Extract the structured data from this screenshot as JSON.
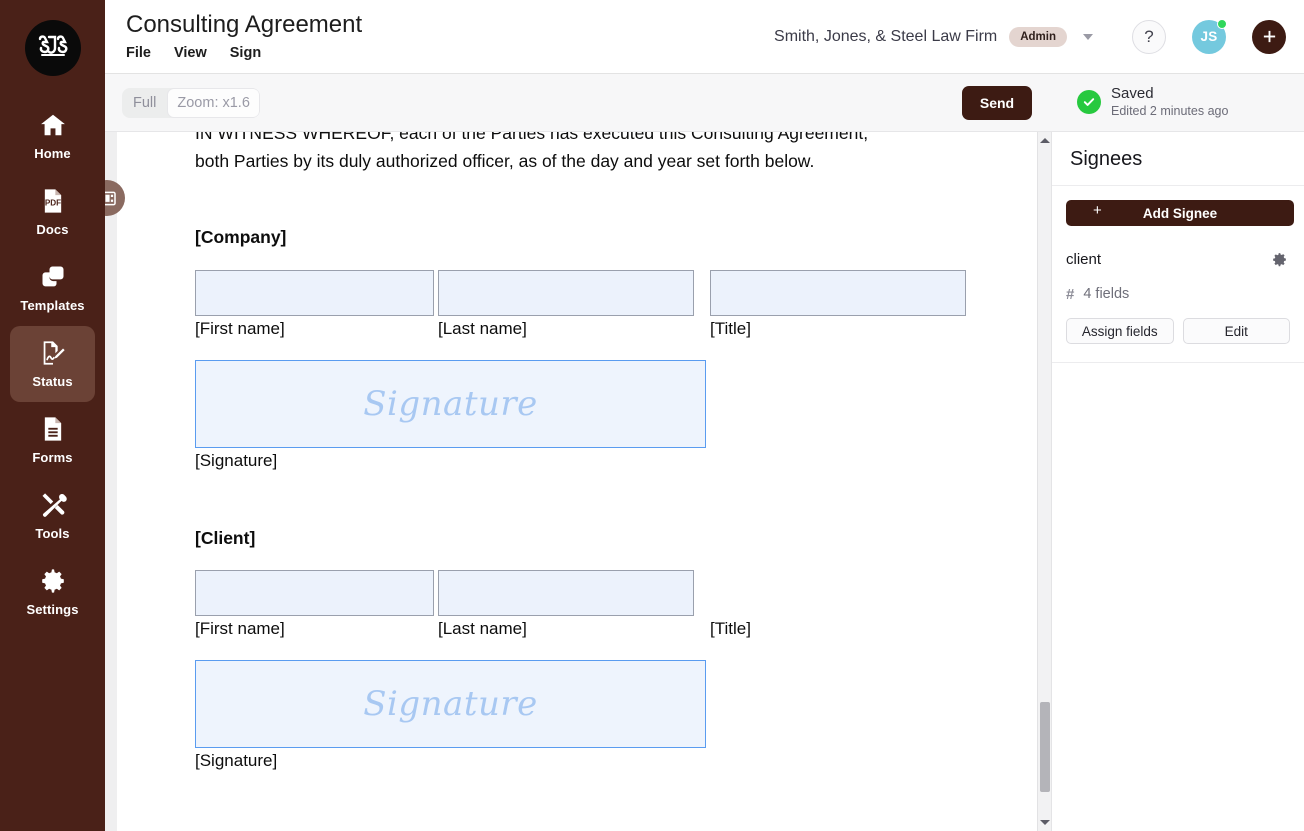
{
  "rail": {
    "logo_text": "SJS",
    "items": [
      {
        "label": "Home",
        "icon": "home-icon",
        "active": false
      },
      {
        "label": "Docs",
        "icon": "pdf-document-icon",
        "active": false
      },
      {
        "label": "Templates",
        "icon": "templates-copy-icon",
        "active": false
      },
      {
        "label": "Status",
        "icon": "document-signing-icon",
        "active": true
      },
      {
        "label": "Forms",
        "icon": "forms-lines-icon",
        "active": false
      },
      {
        "label": "Tools",
        "icon": "tools-wrench-screwdriver-icon",
        "active": false
      },
      {
        "label": "Settings",
        "icon": "gear-icon",
        "active": false
      }
    ]
  },
  "header": {
    "title": "Consulting Agreement",
    "menu": [
      "File",
      "View",
      "Sign"
    ],
    "org_name": "Smith, Jones, & Steel Law Firm",
    "role_badge": "Admin",
    "help_label": "?",
    "avatar_initials": "JS",
    "add_label": "+"
  },
  "toolbar": {
    "fit_label": "Full",
    "zoom_label": "Zoom: x1.6",
    "send_label": "Send",
    "save_status": "Saved",
    "save_subtext": "Edited 2 minutes ago"
  },
  "document": {
    "paragraph_clipped": "IN WITNESS WHEREOF, each of the Parties has executed this Consulting Agreement,",
    "paragraph_line2": "both Parties by its duly authorized officer, as of the day and year set forth below.",
    "signature_placeholder": "Signature",
    "sections": [
      {
        "heading": "[Company]",
        "name_fields": [
          {
            "label": "[First name]",
            "has_input": true
          },
          {
            "label": "[Last name]",
            "has_input": true
          },
          {
            "label": "[Title]",
            "has_input": true
          }
        ],
        "signature_label": "[Signature]"
      },
      {
        "heading": "[Client]",
        "name_fields": [
          {
            "label": "[First name]",
            "has_input": true
          },
          {
            "label": "[Last name]",
            "has_input": true
          },
          {
            "label": "[Title]",
            "has_input": false
          }
        ],
        "signature_label": "[Signature]"
      }
    ]
  },
  "panel": {
    "title": "Signees",
    "add_signee_label": "Add Signee",
    "add_signee_plus": "+",
    "signee": {
      "name": "client",
      "fields_count_label": "4 fields",
      "hash_symbol": "#",
      "assign_label": "Assign fields",
      "edit_label": "Edit"
    }
  },
  "colors": {
    "rail_bg": "#4a2118",
    "rail_active": "#6b4236",
    "accent_dark": "#3d1b13",
    "badge_bg": "#e4d5d0",
    "avatar_bg": "#74c9de",
    "presence_green": "#2fd75b",
    "saved_green": "#27c93f",
    "field_fill": "#ecf2fc",
    "field_border": "#9aa0ad",
    "signature_border": "#5a9cf0",
    "signature_text": "#a8c8f2"
  }
}
